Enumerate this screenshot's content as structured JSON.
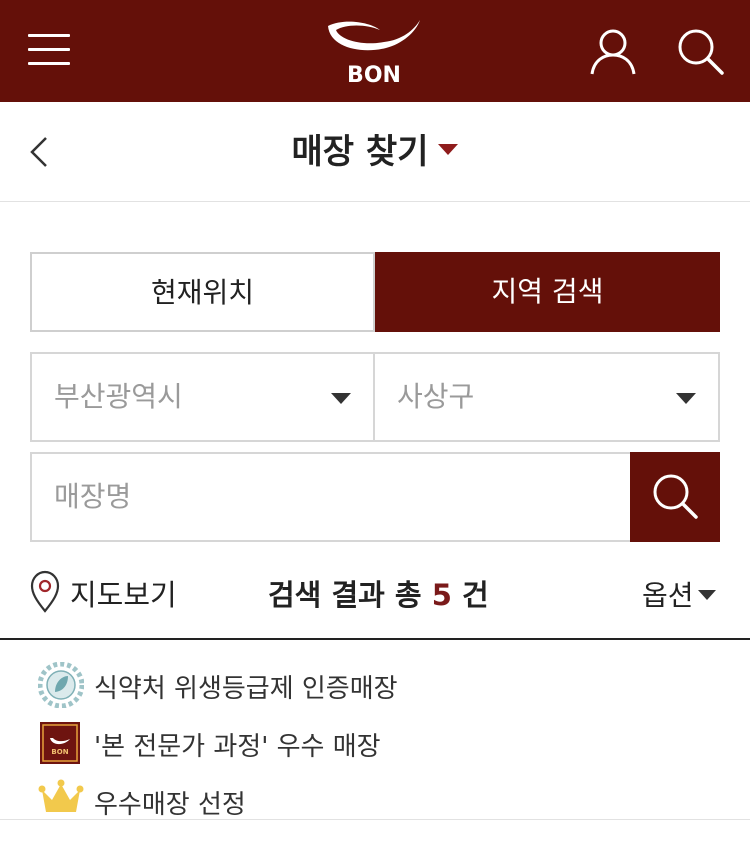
{
  "header": {
    "brand": "BON",
    "brand_color": "#641009",
    "icons": [
      "menu-icon",
      "bon-logo",
      "user-icon",
      "search-icon"
    ]
  },
  "titlebar": {
    "title": "매장 찾기"
  },
  "tabs": [
    {
      "label": "현재위치",
      "active": false
    },
    {
      "label": "지역 검색",
      "active": true
    }
  ],
  "filters": {
    "city": "부산광역시",
    "district": "사상구"
  },
  "search": {
    "placeholder": "매장명"
  },
  "results": {
    "map_label": "지도보기",
    "prefix": "검색 결과 총",
    "count": "5",
    "suffix": "건",
    "option_label": "옵션"
  },
  "legend": [
    {
      "icon": "hygiene-grade-badge-icon",
      "label": "식약처 위생등급제 인증매장"
    },
    {
      "icon": "bon-expert-badge-icon",
      "label": "'본 전문가 과정' 우수 매장"
    },
    {
      "icon": "crown-icon",
      "label": "우수매장 선정"
    }
  ]
}
